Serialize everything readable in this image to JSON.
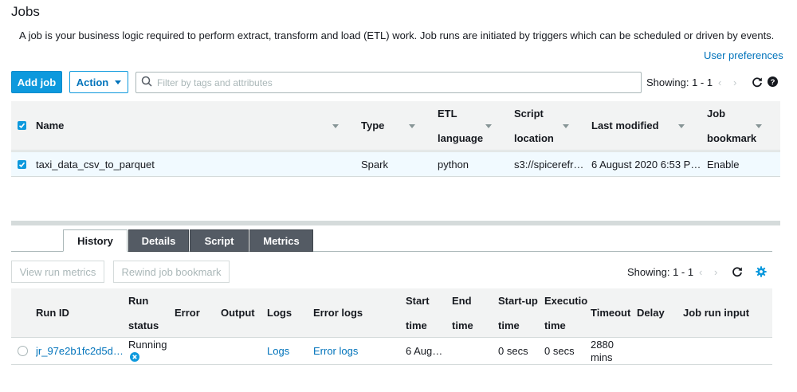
{
  "page": {
    "title": "Jobs",
    "description": "A job is your business logic required to perform extract, transform and load (ETL) work. Job runs are initiated by triggers which can be scheduled or driven by events.",
    "user_preferences": "User preferences"
  },
  "toolbar": {
    "add_job": "Add job",
    "action": "Action",
    "search_placeholder": "Filter by tags and attributes",
    "showing": "Showing: 1 - 1"
  },
  "jobs_table": {
    "columns": {
      "name": "Name",
      "type": "Type",
      "etl_line1": "ETL",
      "etl_line2": "language",
      "script_line1": "Script",
      "script_line2": "location",
      "last_modified": "Last modified",
      "bookmark_line1": "Job",
      "bookmark_line2": "bookmark"
    },
    "rows": [
      {
        "name": "taxi_data_csv_to_parquet",
        "type": "Spark",
        "etl_language": "python",
        "script_location": "s3://spicerefr…",
        "last_modified": "6 August 2020 6:53 P…",
        "job_bookmark": "Enable"
      }
    ]
  },
  "tabs": [
    {
      "label": "History",
      "active": true
    },
    {
      "label": "Details",
      "active": false
    },
    {
      "label": "Script",
      "active": false
    },
    {
      "label": "Metrics",
      "active": false
    }
  ],
  "history": {
    "view_run_metrics": "View run metrics",
    "rewind_job_bookmark": "Rewind job bookmark",
    "showing": "Showing: 1 - 1",
    "columns": {
      "run_id": "Run ID",
      "run_status_line1": "Run",
      "run_status_line2": "status",
      "error": "Error",
      "output": "Output",
      "logs": "Logs",
      "error_logs": "Error logs",
      "start_line1": "Start",
      "start_line2": "time",
      "end_line1": "End",
      "end_line2": "time",
      "startup_line1": "Start-up",
      "startup_line2": "time",
      "exec_line1": "Executio",
      "exec_line2": "time",
      "timeout": "Timeout",
      "delay": "Delay",
      "job_run_input": "Job run input"
    },
    "rows": [
      {
        "run_id": "jr_97e2b1fc2d5d…",
        "run_status": "Running",
        "logs": "Logs",
        "error_logs": "Error logs",
        "start_time": "6 Aug…",
        "startup_time": "0 secs",
        "execution_time": "0 secs",
        "timeout_line1": "2880",
        "timeout_line2": "mins"
      }
    ]
  },
  "colors": {
    "accent": "#0d99dd",
    "link": "#0073bb",
    "selected_row": "#f1faff",
    "header_bg": "#f2f3f3",
    "tab_inactive": "#545b64"
  },
  "icons": [
    "search-icon",
    "refresh-icon",
    "help-icon",
    "settings-icon",
    "chevron-left-icon",
    "chevron-right-icon",
    "cancel-run-icon",
    "checkbox-checked-icon"
  ]
}
